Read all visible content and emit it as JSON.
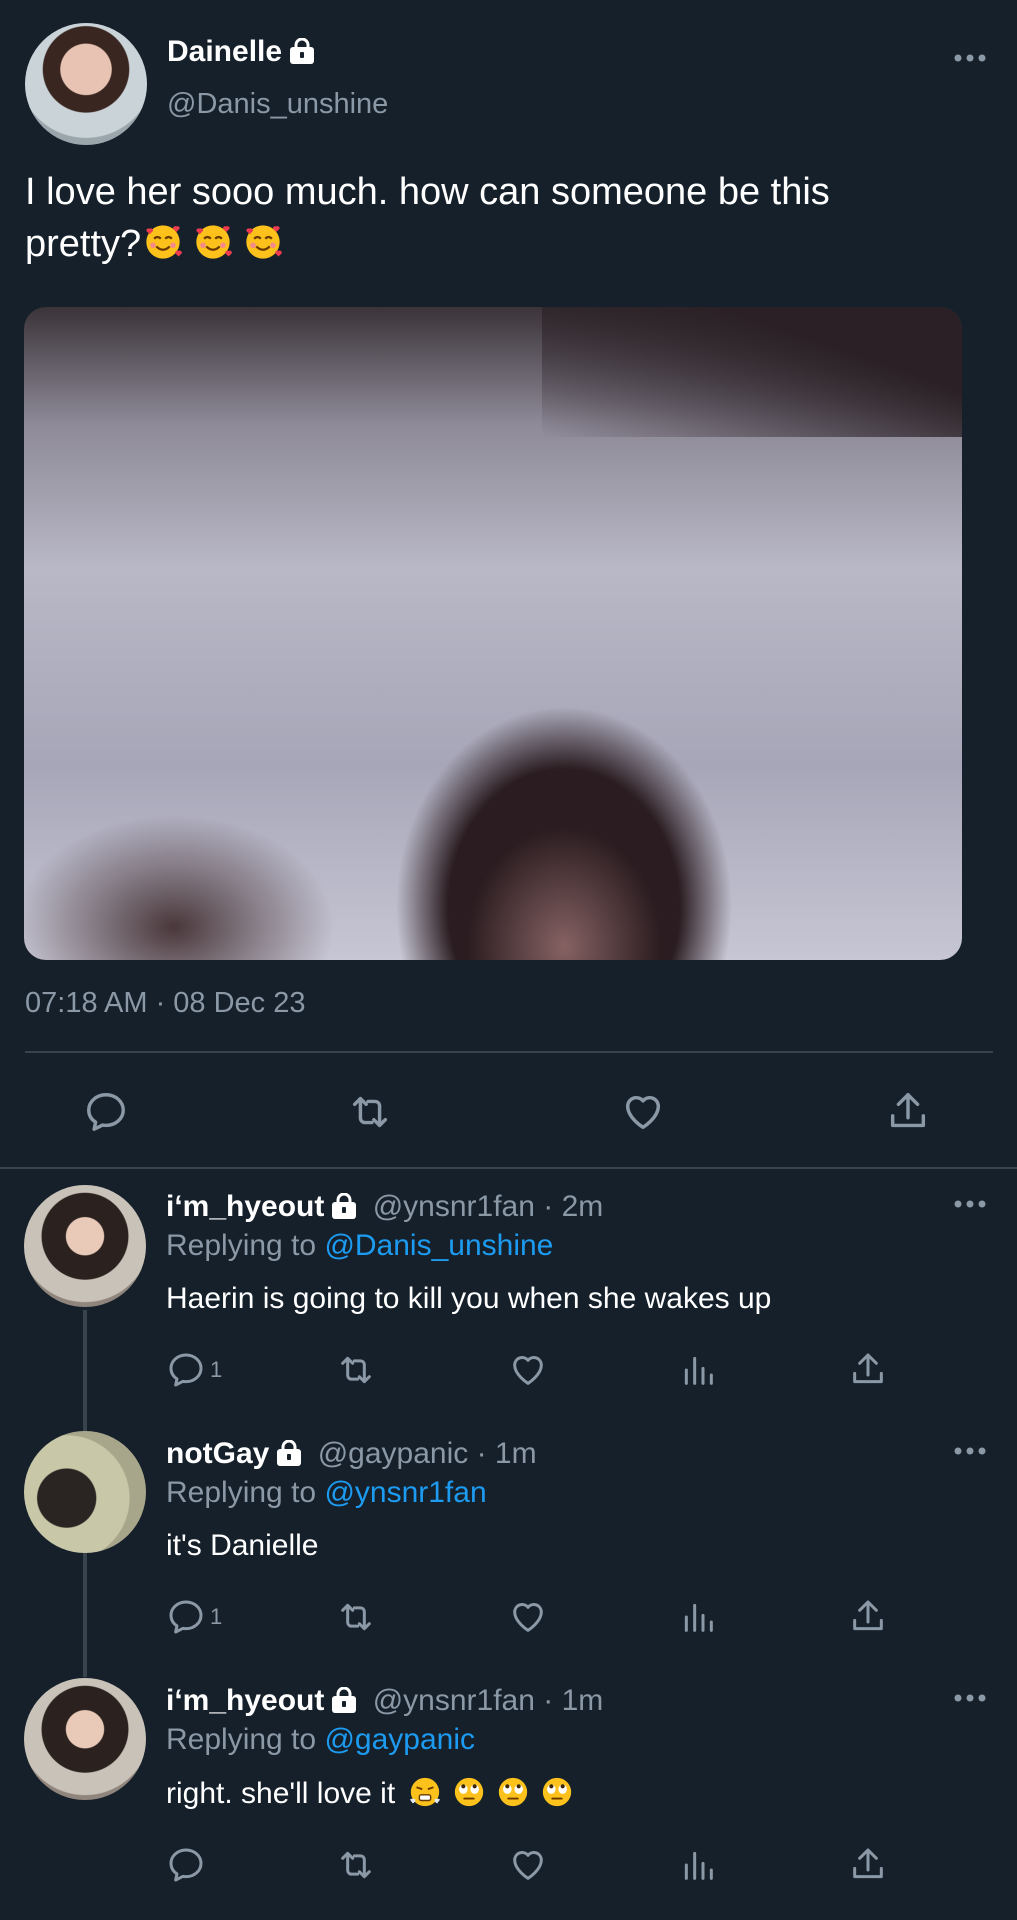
{
  "main_tweet": {
    "display_name": "Dainelle",
    "handle": "@Danis_unshine",
    "text_line1": "I love her sooo much. how can someone be this",
    "text_line2": "pretty?",
    "emojis": [
      "smiling-face-with-hearts",
      "smiling-face-with-hearts",
      "smiling-face-with-hearts"
    ],
    "timestamp": "07:18 AM · 08 Dec 23",
    "photo_description": "blurred photo of person sleeping in bed"
  },
  "replies": [
    {
      "display_name": "i‘m_hyeout",
      "handle": "@ynsnr1fan",
      "time": "· 2m",
      "replying_label": "Replying to",
      "replying_to": "@Danis_unshine",
      "text": "Haerin is going to kill you when she wakes up",
      "reply_count": "1"
    },
    {
      "display_name": "notGay",
      "handle": "@gaypanic",
      "time": "· 1m",
      "replying_label": "Replying to",
      "replying_to": "@ynsnr1fan",
      "text": "it's Danielle",
      "reply_count": "1"
    },
    {
      "display_name": "i‘m_hyeout",
      "handle": "@ynsnr1fan",
      "time": "· 1m",
      "replying_label": "Replying to",
      "replying_to": "@gaypanic",
      "text": "right. she'll love it",
      "reply_count": ""
    }
  ],
  "colors": {
    "background": "#15202b",
    "muted": "#8b98a5",
    "link": "#1d9bf0",
    "divider": "#38444d"
  }
}
